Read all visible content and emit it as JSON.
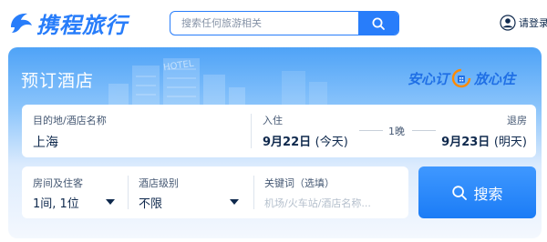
{
  "brand": {
    "logo_text": "携程旅行",
    "accent": "#287dfa"
  },
  "header": {
    "search": {
      "placeholder": "搜索任何旅游相关",
      "value": "",
      "button_icon": "search-icon"
    },
    "user": {
      "icon": "user-circle-icon",
      "label": "请登录"
    }
  },
  "panel": {
    "title": "预订酒店",
    "slogan_left": "安心订",
    "slogan_right": "放心住",
    "slogan_icon": "hotel-badge-icon",
    "destination": {
      "label": "目的地/酒店名称",
      "value": "上海"
    },
    "checkin": {
      "label": "入住",
      "date": "9月22日",
      "weekday": "(今天)"
    },
    "nights": "1晚",
    "checkout": {
      "label": "退房",
      "date": "9月23日",
      "weekday": "(明天)"
    },
    "rooms": {
      "label": "房间及住客",
      "value": "1间, 1位",
      "icon": "caret-down-icon"
    },
    "star": {
      "label": "酒店级别",
      "value": "不限",
      "icon": "caret-down-icon"
    },
    "keyword": {
      "label": "关键词（选填）",
      "placeholder": "机场/火车站/酒店名称..."
    },
    "search_button": {
      "label": "搜索",
      "icon": "search-icon"
    }
  }
}
